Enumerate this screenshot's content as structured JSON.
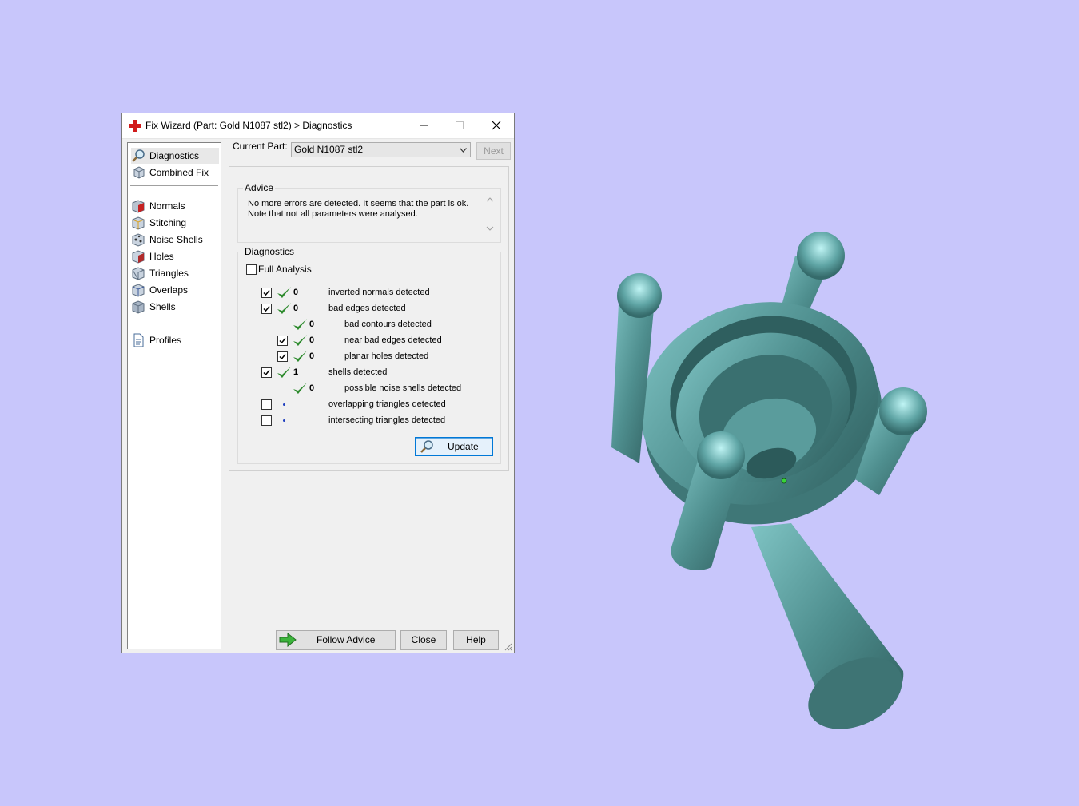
{
  "window": {
    "title": "Fix Wizard (Part: Gold N1087 stl2) > Diagnostics",
    "title_icon": "red-cross-icon",
    "controls": [
      "minimize-icon",
      "maximize-icon",
      "close-icon"
    ]
  },
  "nav": {
    "items": [
      {
        "label": "Diagnostics",
        "icon": "magnifier-icon",
        "selected": true
      },
      {
        "label": "Combined Fix",
        "icon": "cube-stack-icon",
        "selected": false
      },
      {
        "label": "Normals",
        "icon": "normals-cube-icon",
        "selected": false
      },
      {
        "label": "Stitching",
        "icon": "stitching-cube-icon",
        "selected": false
      },
      {
        "label": "Noise Shells",
        "icon": "noise-shells-cube-icon",
        "selected": false
      },
      {
        "label": "Holes",
        "icon": "holes-cube-icon",
        "selected": false
      },
      {
        "label": "Triangles",
        "icon": "triangles-cube-icon",
        "selected": false
      },
      {
        "label": "Overlaps",
        "icon": "overlaps-cube-icon",
        "selected": false
      },
      {
        "label": "Shells",
        "icon": "shells-cube-icon",
        "selected": false
      },
      {
        "label": "Profiles",
        "icon": "document-icon",
        "selected": false
      }
    ]
  },
  "current_part": {
    "label": "Current Part:",
    "value": "Gold N1087 stl2",
    "next_label": "Next"
  },
  "advice": {
    "title": "Advice",
    "text": "No more errors are detected. It seems that the part is ok. Note that not all parameters were analysed."
  },
  "diagnostics": {
    "title": "Diagnostics",
    "full_analysis": {
      "label": "Full Analysis",
      "checked": false
    },
    "rows": [
      {
        "checkbox": true,
        "checked": true,
        "status": "check",
        "count": "0",
        "label": "inverted normals detected"
      },
      {
        "checkbox": true,
        "checked": true,
        "status": "check",
        "count": "0",
        "label": "bad edges detected"
      },
      {
        "checkbox": false,
        "checked": false,
        "status": "check",
        "count": "0",
        "label": "bad contours detected"
      },
      {
        "checkbox": true,
        "checked": true,
        "status": "check",
        "count": "0",
        "label": "near bad edges detected"
      },
      {
        "checkbox": true,
        "checked": true,
        "status": "check",
        "count": "0",
        "label": "planar holes detected"
      },
      {
        "checkbox": true,
        "checked": true,
        "status": "check",
        "count": "1",
        "label": "shells detected"
      },
      {
        "checkbox": false,
        "checked": false,
        "status": "check",
        "count": "0",
        "label": "possible noise shells detected"
      },
      {
        "checkbox": true,
        "checked": false,
        "status": "dot",
        "count": "",
        "label": "overlapping triangles detected"
      },
      {
        "checkbox": true,
        "checked": false,
        "status": "dot",
        "count": "",
        "label": "intersecting triangles detected"
      }
    ],
    "update_label": "Update"
  },
  "buttons": {
    "follow_advice": "Follow Advice",
    "close": "Close",
    "help": "Help"
  },
  "colors": {
    "background": "#c8c6fb",
    "model": "#4f8f8f",
    "check_green": "#2e8b2e"
  }
}
